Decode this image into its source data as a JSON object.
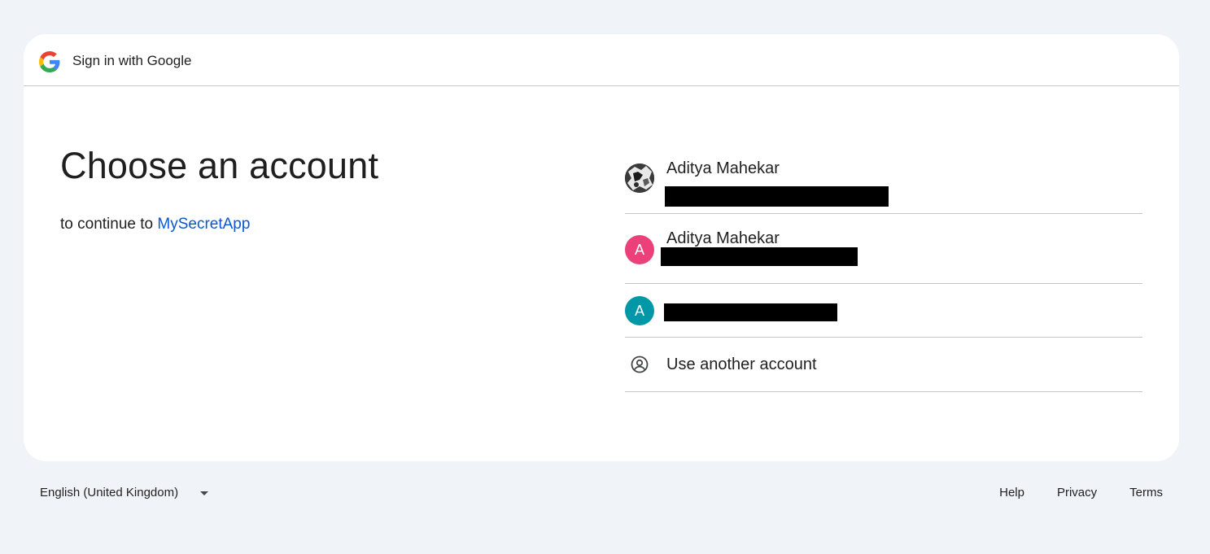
{
  "header": {
    "logo_icon": "google-g-logo",
    "title": "Sign in with Google"
  },
  "main": {
    "heading": "Choose an account",
    "subtitle_prefix": "to continue to",
    "app_name": "MySecretApp"
  },
  "accounts": [
    {
      "name": "Aditya Mahekar",
      "avatar": "profile-photo",
      "email_redacted": true
    },
    {
      "name": "Aditya Mahekar",
      "avatar_letter": "A",
      "avatar_color": "#ec407a",
      "email_redacted": true
    },
    {
      "avatar_letter": "A",
      "avatar_color": "#0097a7",
      "email_redacted": true
    }
  ],
  "use_another": {
    "label": "Use another account",
    "icon": "account-circle-icon"
  },
  "footer": {
    "language": "English (United Kingdom)",
    "links": {
      "help": "Help",
      "privacy": "Privacy",
      "terms": "Terms"
    }
  },
  "colors": {
    "page_background": "#f0f4f9",
    "card_background": "#ffffff",
    "link": "#0b57d0",
    "divider": "#c4c7c5"
  }
}
